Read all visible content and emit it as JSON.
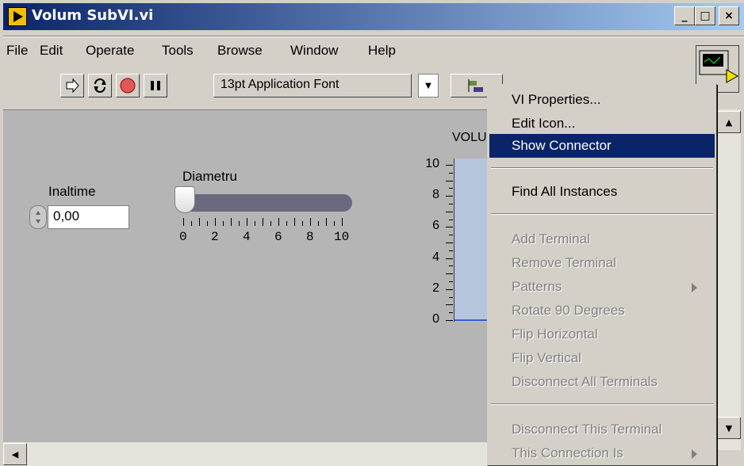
{
  "window": {
    "title": "Volum SubVI.vi"
  },
  "title_buttons": {
    "minimize": "_",
    "maximize": "□",
    "close": "×"
  },
  "menu": {
    "items": [
      {
        "label": "File"
      },
      {
        "label": "Edit"
      },
      {
        "label": "Operate"
      },
      {
        "label": "Tools"
      },
      {
        "label": "Browse"
      },
      {
        "label": "Window"
      },
      {
        "label": "Help"
      }
    ]
  },
  "toolbar": {
    "font": "13pt Application Font"
  },
  "panel": {
    "inaltime_label": "Inaltime",
    "inaltime_value": "0,00",
    "diametru_label": "Diametru",
    "slider_scale": [
      "0",
      "2",
      "4",
      "6",
      "8",
      "10"
    ],
    "slider_value": 0,
    "chart_label": "VOLU",
    "chart_ticks": [
      "10",
      "8",
      "6",
      "4",
      "2",
      "0"
    ]
  },
  "chart_data": {
    "type": "bar",
    "title": "VOLU",
    "ylim": [
      0,
      10
    ],
    "y_ticks": [
      10,
      8,
      6,
      4,
      2,
      0
    ]
  },
  "context_menu": {
    "items": [
      {
        "label": "VI Properties...",
        "enabled": true
      },
      {
        "label": "Edit Icon...",
        "enabled": true
      },
      {
        "label": "Show Connector",
        "enabled": true,
        "highlighted": true
      },
      {
        "label": "Find All Instances",
        "enabled": true
      },
      {
        "label": "Add Terminal",
        "enabled": false
      },
      {
        "label": "Remove Terminal",
        "enabled": false
      },
      {
        "label": "Patterns",
        "enabled": false,
        "submenu": true
      },
      {
        "label": "Rotate 90 Degrees",
        "enabled": false
      },
      {
        "label": "Flip Horizontal",
        "enabled": false
      },
      {
        "label": "Flip Vertical",
        "enabled": false
      },
      {
        "label": "Disconnect All Terminals",
        "enabled": false
      },
      {
        "label": "Disconnect This Terminal",
        "enabled": false
      },
      {
        "label": "This Connection Is",
        "enabled": false,
        "submenu": true
      }
    ]
  }
}
